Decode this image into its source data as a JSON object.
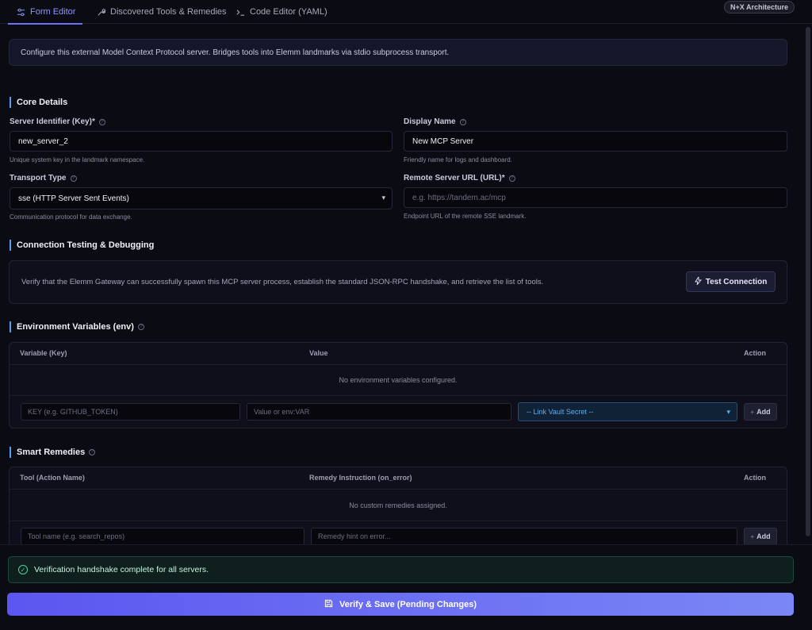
{
  "tabs": [
    {
      "label": "Form Editor",
      "icon": "sliders-icon"
    },
    {
      "label": "Discovered Tools & Remedies",
      "icon": "wrench-icon"
    },
    {
      "label": "Code Editor (YAML)",
      "icon": "terminal-icon"
    }
  ],
  "arch_badge": "N+X Architecture",
  "info_banner": "Configure this external Model Context Protocol server. Bridges tools into Elemm landmarks via stdio subprocess transport.",
  "core": {
    "title": "Core Details",
    "server_id": {
      "label": "Server Identifier (Key)",
      "required": "*",
      "value": "new_server_2",
      "hint": "Unique system key in the landmark namespace."
    },
    "display_name": {
      "label": "Display Name",
      "value": "New MCP Server",
      "hint": "Friendly name for logs and dashboard."
    },
    "transport": {
      "label": "Transport Type",
      "value": "sse (HTTP Server Sent Events)",
      "hint": "Communication protocol for data exchange."
    },
    "remote_url": {
      "label": "Remote Server URL (URL)",
      "required": "*",
      "placeholder": "e.g. https://tandem.ac/mcp",
      "hint": "Endpoint URL of the remote SSE landmark."
    }
  },
  "connection": {
    "title": "Connection Testing & Debugging",
    "text": "Verify that the Elemm Gateway can successfully spawn this MCP server process, establish the standard JSON-RPC handshake, and retrieve the list of tools.",
    "button": "Test Connection"
  },
  "env": {
    "title": "Environment Variables (env)",
    "columns": [
      "Variable (Key)",
      "Value",
      "Action"
    ],
    "empty": "No environment variables configured.",
    "key_placeholder": "KEY (e.g. GITHUB_TOKEN)",
    "value_placeholder": "Value or env:VAR",
    "vault_select": "-- Link Vault Secret --",
    "add": "Add"
  },
  "remedies": {
    "title": "Smart Remedies",
    "columns": [
      "Tool (Action Name)",
      "Remedy Instruction (on_error)",
      "Action"
    ],
    "empty": "No custom remedies assigned.",
    "tool_placeholder": "Tool name (e.g. search_repos)",
    "hint_placeholder": "Remedy hint on error...",
    "add": "Add"
  },
  "status": "Verification handshake complete for all servers.",
  "save_button": "Verify & Save (Pending Changes)",
  "colors": {
    "accent": "#6b72f5",
    "success": "#4fd1a5",
    "section_bar": "#5b9cf5"
  }
}
